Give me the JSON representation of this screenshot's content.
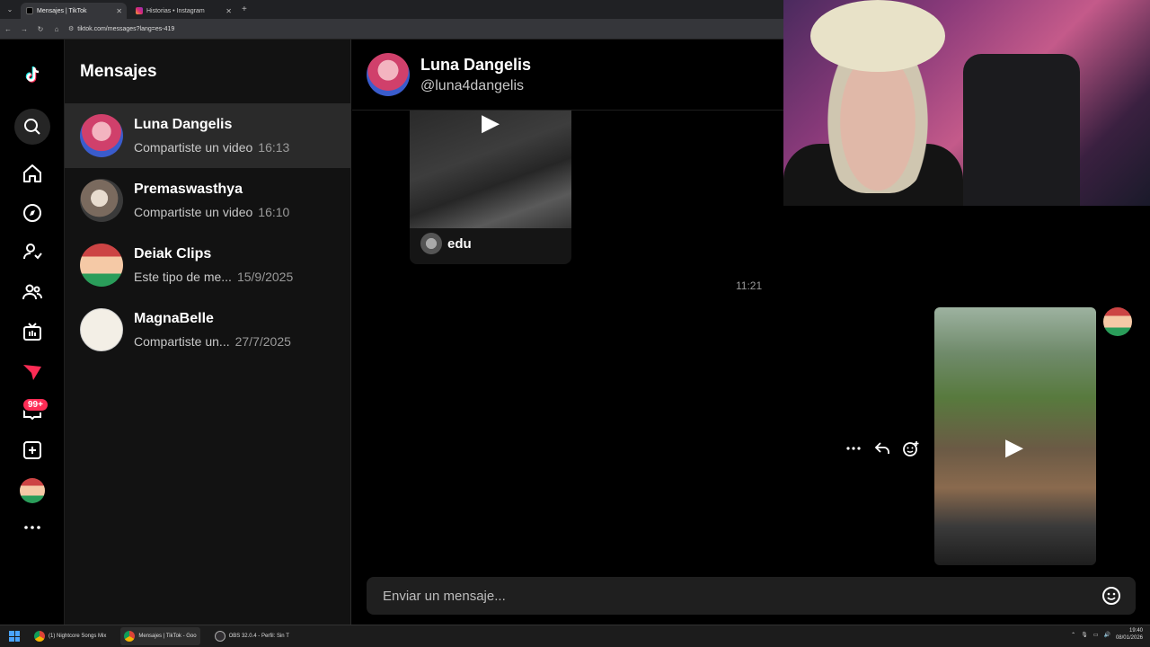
{
  "browser": {
    "tabs": [
      {
        "title": "Mensajes | TikTok",
        "active": true
      },
      {
        "title": "Historias • Instagram",
        "active": false
      }
    ],
    "url": "tiktok.com/messages?lang=es-419"
  },
  "sidebar": {
    "icons": [
      "tiktok-logo",
      "search-icon",
      "home-icon",
      "explore-icon",
      "following-icon",
      "friends-icon",
      "live-icon",
      "send-icon",
      "inbox-icon",
      "upload-icon",
      "profile-avatar",
      "more-icon"
    ],
    "inbox_badge": "99+"
  },
  "conversations": {
    "title": "Mensajes",
    "items": [
      {
        "name": "Luna Dangelis",
        "preview": "Compartiste un video",
        "time": "16:13",
        "active": true
      },
      {
        "name": "Premaswasthya",
        "preview": "Compartiste un video",
        "time": "16:10",
        "active": false
      },
      {
        "name": "Deiak Clips",
        "preview": "Este tipo de me...",
        "time": "15/9/2025",
        "active": false
      },
      {
        "name": "MagnaBelle",
        "preview": "Compartiste un...",
        "time": "27/7/2025",
        "active": false
      }
    ]
  },
  "chat": {
    "header": {
      "name": "Luna Dangelis",
      "handle": "@luna4dangelis"
    },
    "shared_video_author": "edu",
    "timestamp": "11:21",
    "composer_placeholder": "Enviar un mensaje..."
  },
  "taskbar": {
    "apps": [
      {
        "label": "(1) Nightcore Songs Mix",
        "active": false
      },
      {
        "label": "Mensajes | TikTok - Goo",
        "active": true
      },
      {
        "label": "OBS 32.0.4 - Perfil: Sin T",
        "active": false
      }
    ],
    "time": "19:40",
    "date": "08/01/2026"
  },
  "colors": {
    "accent": "#fe2c55",
    "background": "#000000",
    "panel": "#121212"
  }
}
